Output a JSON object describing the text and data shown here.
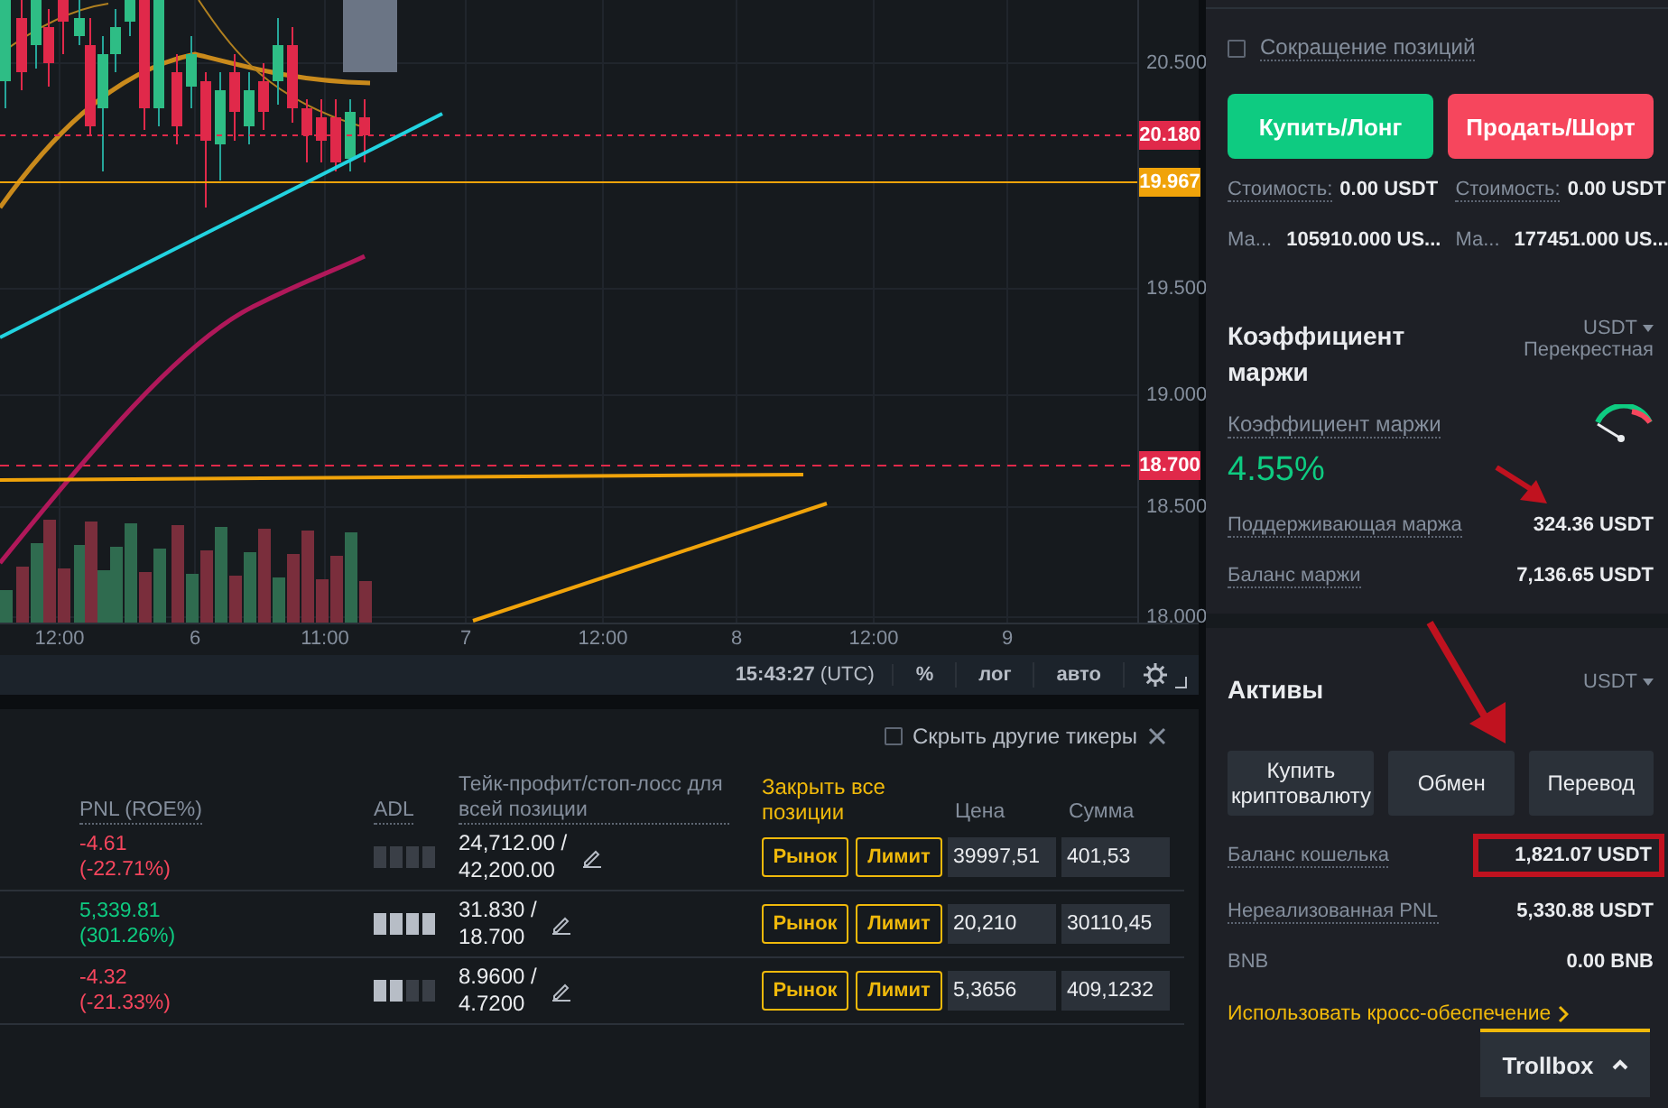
{
  "chart": {
    "price_ticks": [
      "20.500",
      "19.500",
      "19.000",
      "18.500",
      "18.000"
    ],
    "price_labels": [
      {
        "text": "20.180",
        "color": "#e0294a"
      },
      {
        "text": "19.967",
        "color": "#f0a30a"
      },
      {
        "text": "18.700",
        "color": "#e0294a"
      }
    ],
    "time_labels": [
      "12:00",
      "6",
      "11:00",
      "7",
      "12:00",
      "8",
      "12:00",
      "9"
    ]
  },
  "chart_toolbar": {
    "time": "15:43:27",
    "timezone": "(UTC)",
    "buttons": [
      "%",
      "лог",
      "авто"
    ]
  },
  "positions": {
    "hide_other": {
      "label": "Скрыть другие тикеры",
      "checked": false
    },
    "columns": [
      "PNL (ROE%)",
      "ADL",
      "Тейк-профит/стоп-лосс для всей позиции"
    ],
    "close_all": "Закрыть все позиции",
    "price_column": "Цена",
    "amount_column": "Сумма",
    "rows": [
      {
        "pnl": "-4.61",
        "roe": "(-22.71%)",
        "color": "#f6465d",
        "stars": 0,
        "tp": "24,712.00 /",
        "sl": "42,200.00",
        "market": "Рынок",
        "limit": "Лимит",
        "price": "39997,51",
        "amount": "401,53"
      },
      {
        "pnl": "5,339.81",
        "roe": "(301.26%)",
        "color": "#0ecb81",
        "stars": 4,
        "tp": "31.830 /",
        "sl": "18.700",
        "market": "Рынок",
        "limit": "Лимит",
        "price": "20,210",
        "amount": "30110,45"
      },
      {
        "pnl": "-4.32",
        "roe": "(-21.33%)",
        "color": "#f6465d",
        "stars": 2,
        "tp": "8.9600 /",
        "sl": "4.7200",
        "market": "Рынок",
        "limit": "Лимит",
        "price": "5,3656",
        "amount": "409,1232"
      }
    ]
  },
  "order": {
    "reduce_only": {
      "label": "Сокращение позиций",
      "checked": false
    },
    "buy": "Купить/Лонг",
    "sell": "Продать/Шорт",
    "costs": [
      {
        "label": "Стоимость:",
        "value": "0.00 USDT"
      },
      {
        "label": "Стоимость:",
        "value": "0.00 USDT"
      }
    ],
    "max": [
      {
        "label": "Ма...",
        "value": "105910.000 US..."
      },
      {
        "label": "Ма...",
        "value": "177451.000 US..."
      }
    ]
  },
  "margin": {
    "title": "Коэффициент маржи",
    "currency": "USDT",
    "mode": "Перекрестная",
    "ratio_label": "Коэффициент маржи",
    "ratio": "4.55%",
    "rows": [
      {
        "label": "Поддерживающая маржа",
        "value": "324.36 USDT"
      },
      {
        "label": "Баланс маржи",
        "value": "7,136.65 USDT"
      }
    ]
  },
  "assets": {
    "title": "Активы",
    "currency": "USDT",
    "buttons": [
      "Купить криптовалюту",
      "Обмен",
      "Перевод"
    ],
    "rows": [
      {
        "label": "Баланс кошелька",
        "dotted": true,
        "value": "1,821.07 USDT",
        "highlighted": true
      },
      {
        "label": "Нереализованная PNL",
        "dotted": true,
        "value": "5,330.88 USDT",
        "highlighted": false
      },
      {
        "label": "BNB",
        "dotted": false,
        "value": "0.00 BNB",
        "highlighted": false
      }
    ],
    "link": "Использовать кросс-обеспечение"
  },
  "trollbox": "Trollbox"
}
